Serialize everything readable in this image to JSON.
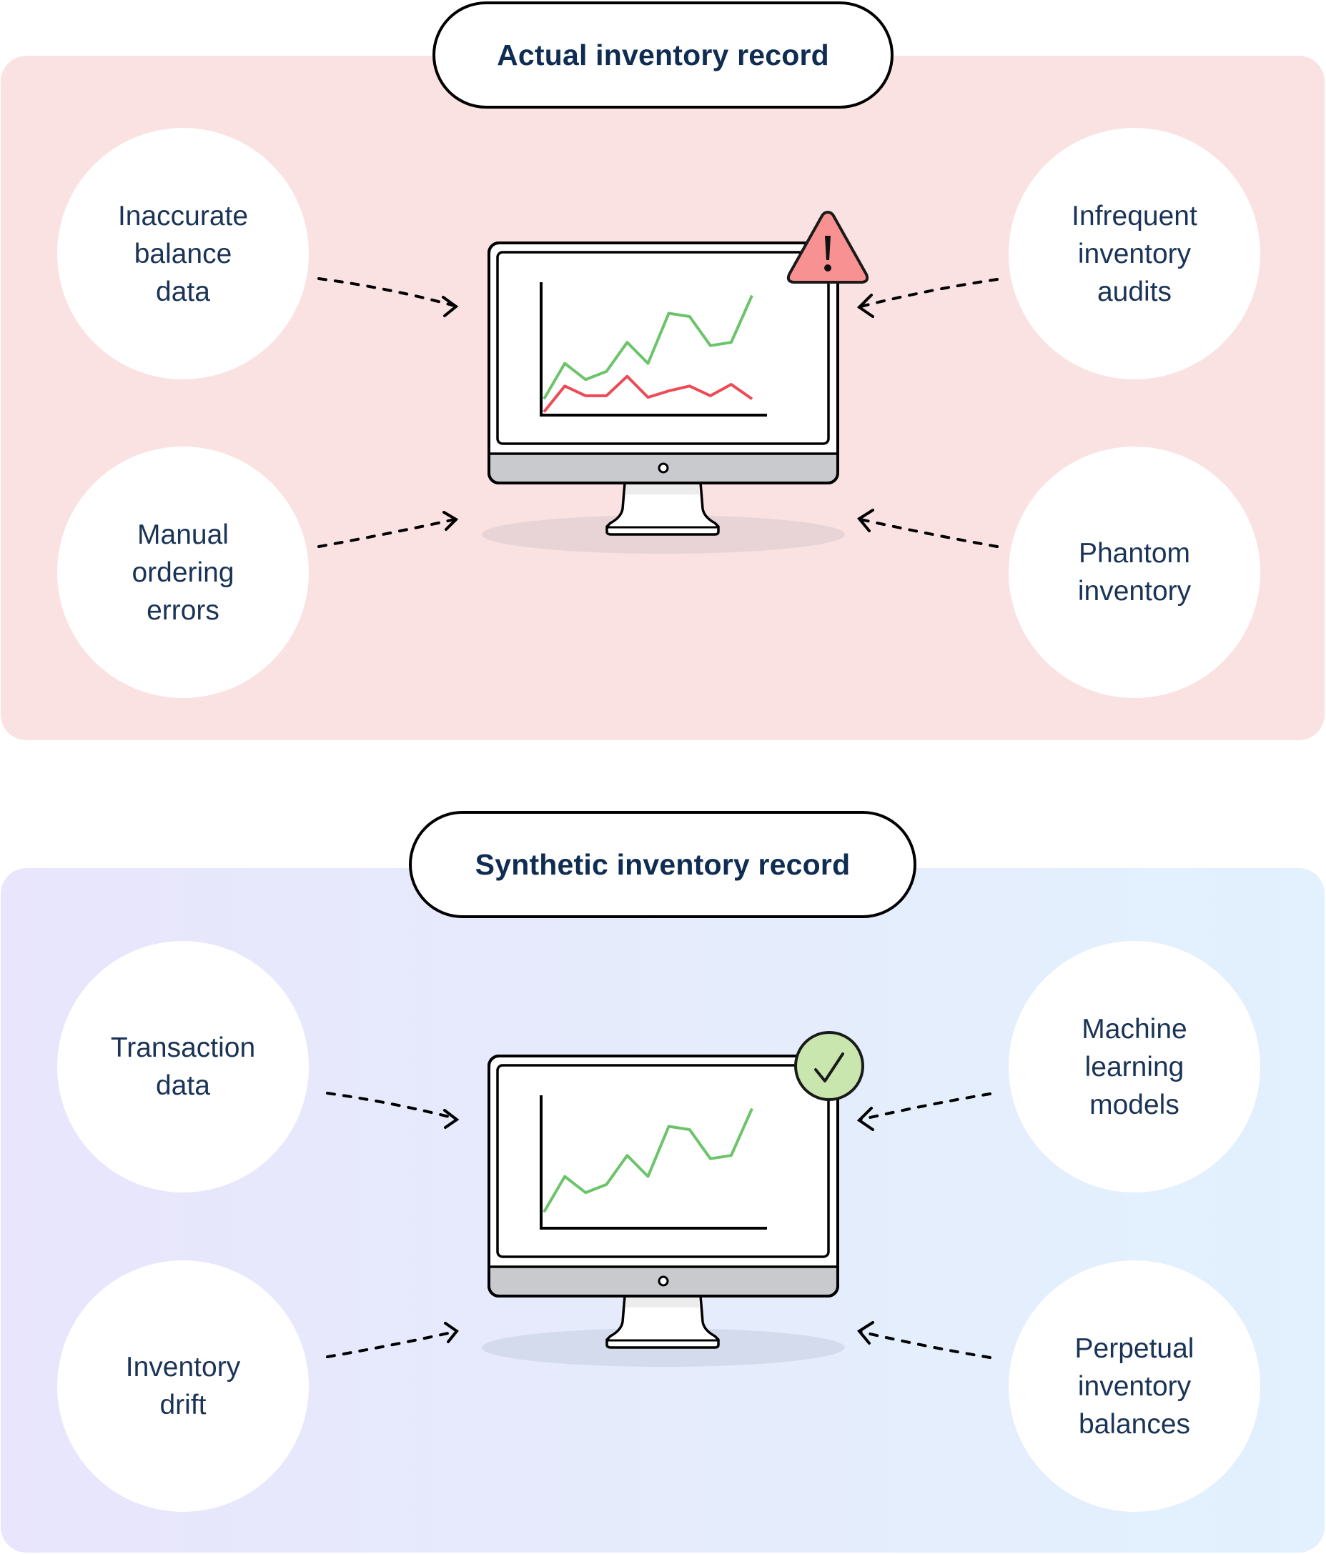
{
  "sections": [
    {
      "id": "actual",
      "title": "Actual inventory record",
      "status_icon": "warning-icon",
      "factors_left": [
        {
          "label": "Inaccurate\nbalance\ndata"
        },
        {
          "label": "Manual\nordering\nerrors"
        }
      ],
      "factors_right": [
        {
          "label": "Infrequent\ninventory\naudits"
        },
        {
          "label": "Phantom\ninventory"
        }
      ]
    },
    {
      "id": "synthetic",
      "title": "Synthetic inventory record",
      "status_icon": "checkmark-icon",
      "factors_left": [
        {
          "label": "Transaction\ndata"
        },
        {
          "label": "Inventory\ndrift"
        }
      ],
      "factors_right": [
        {
          "label": "Machine\nlearning\nmodels"
        },
        {
          "label": "Perpetual\ninventory\nbalances"
        }
      ]
    }
  ],
  "colors": {
    "text_navy": "#0f2d52",
    "actual_bg": "#fae2e3",
    "synthetic_bg_left": "#e8e5fc",
    "synthetic_bg_right": "#e2f1fd",
    "trend_good": "#6cc46a",
    "trend_bad": "#ee4a55",
    "warning_fill": "#f89191",
    "check_fill": "#c8e6ae",
    "monitor_chin": "#c9cace"
  },
  "chart_data": [
    {
      "type": "line",
      "title": "",
      "xlabel": "",
      "ylabel": "",
      "x": [
        0,
        1,
        2,
        3,
        4,
        5,
        6,
        7,
        8,
        9,
        10
      ],
      "series": [
        {
          "name": "green-trend",
          "values": [
            1.0,
            3.2,
            2.2,
            2.7,
            4.5,
            3.2,
            6.3,
            6.1,
            4.3,
            4.5,
            7.4
          ]
        },
        {
          "name": "red-trend",
          "values": [
            0.2,
            1.8,
            1.2,
            1.2,
            2.4,
            1.1,
            1.5,
            1.8,
            1.2,
            1.9,
            1.0
          ]
        }
      ]
    },
    {
      "type": "line",
      "title": "",
      "xlabel": "",
      "ylabel": "",
      "x": [
        0,
        1,
        2,
        3,
        4,
        5,
        6,
        7,
        8,
        9,
        10
      ],
      "series": [
        {
          "name": "green-trend",
          "values": [
            1.0,
            3.2,
            2.2,
            2.7,
            4.5,
            3.2,
            6.3,
            6.1,
            4.3,
            4.5,
            7.4
          ]
        }
      ]
    }
  ]
}
